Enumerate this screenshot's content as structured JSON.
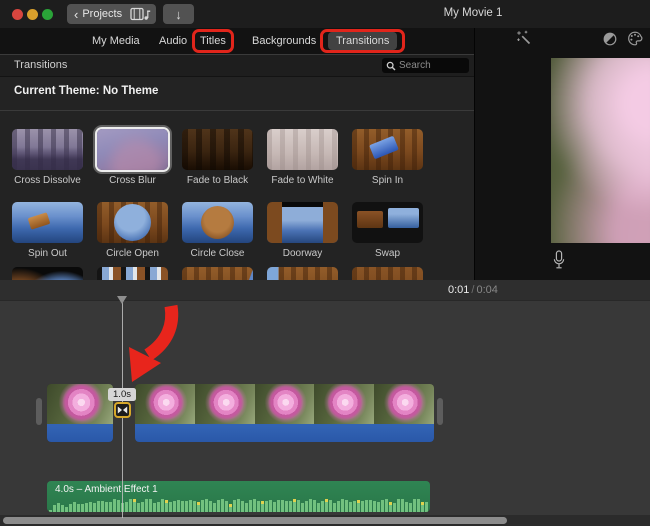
{
  "window": {
    "title": "My Movie 1"
  },
  "toolbar": {
    "projects_label": "Projects"
  },
  "tabs": {
    "my_media": "My Media",
    "audio": "Audio",
    "titles": "Titles",
    "backgrounds": "Backgrounds",
    "transitions": "Transitions"
  },
  "browser": {
    "title": "Transitions",
    "search_placeholder": "Search",
    "current_theme": "Current Theme: No Theme",
    "selected_transition": "Cross Blur",
    "transitions": [
      "Cross Dissolve",
      "Cross Blur",
      "Fade to Black",
      "Fade to White",
      "Spin In",
      "Spin Out",
      "Circle Open",
      "Circle Close",
      "Doorway",
      "Swap"
    ]
  },
  "timeline": {
    "time_current": "0:01",
    "time_sep": "/",
    "time_total": "0:04",
    "transition_duration": "1.0s",
    "audio_label": "4.0s – Ambient Effect 1"
  },
  "colors": {
    "annotation_red": "#e1251b",
    "clip_blue": "#2a58a8",
    "audio_green": "#2f8553",
    "transition_border_yellow": "#d7a82a"
  }
}
